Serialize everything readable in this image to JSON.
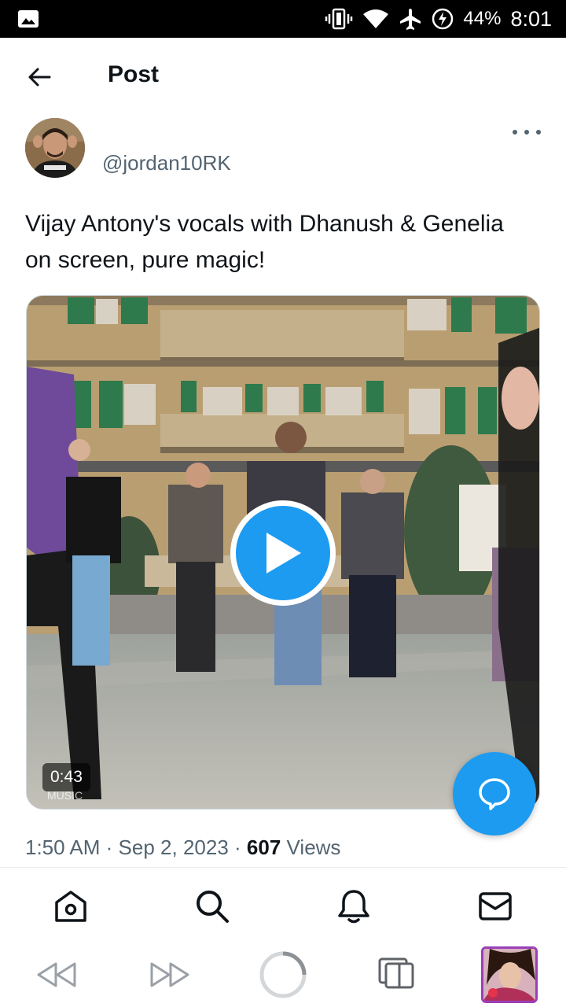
{
  "status_bar": {
    "left_icon": "image-notification-icon",
    "icons": [
      "vibrate-icon",
      "wifi-icon",
      "airplane-icon",
      "battery-charging-icon"
    ],
    "battery": "44%",
    "time": "8:01"
  },
  "header": {
    "title": "Post"
  },
  "post": {
    "handle": "@jordan10RK",
    "text": "Vijay Antony's vocals with Dhanush & Genelia on screen, pure magic!",
    "media": {
      "duration": "0:43",
      "watermark": "MUSIC"
    },
    "time": "1:50 AM",
    "date": "Sep 2, 2023",
    "separator": "·",
    "views_count": "607",
    "views_label": "Views"
  },
  "bottom_nav": [
    "home-icon",
    "search-icon",
    "notifications-icon",
    "messages-icon"
  ],
  "system_nav": [
    "rewind-icon",
    "fast-forward-icon",
    "loading-icon",
    "tabs-icon",
    "recent-app-thumbnail"
  ],
  "colors": {
    "accent": "#1d9bf0",
    "text": "#0f1419",
    "secondary": "#536471"
  }
}
